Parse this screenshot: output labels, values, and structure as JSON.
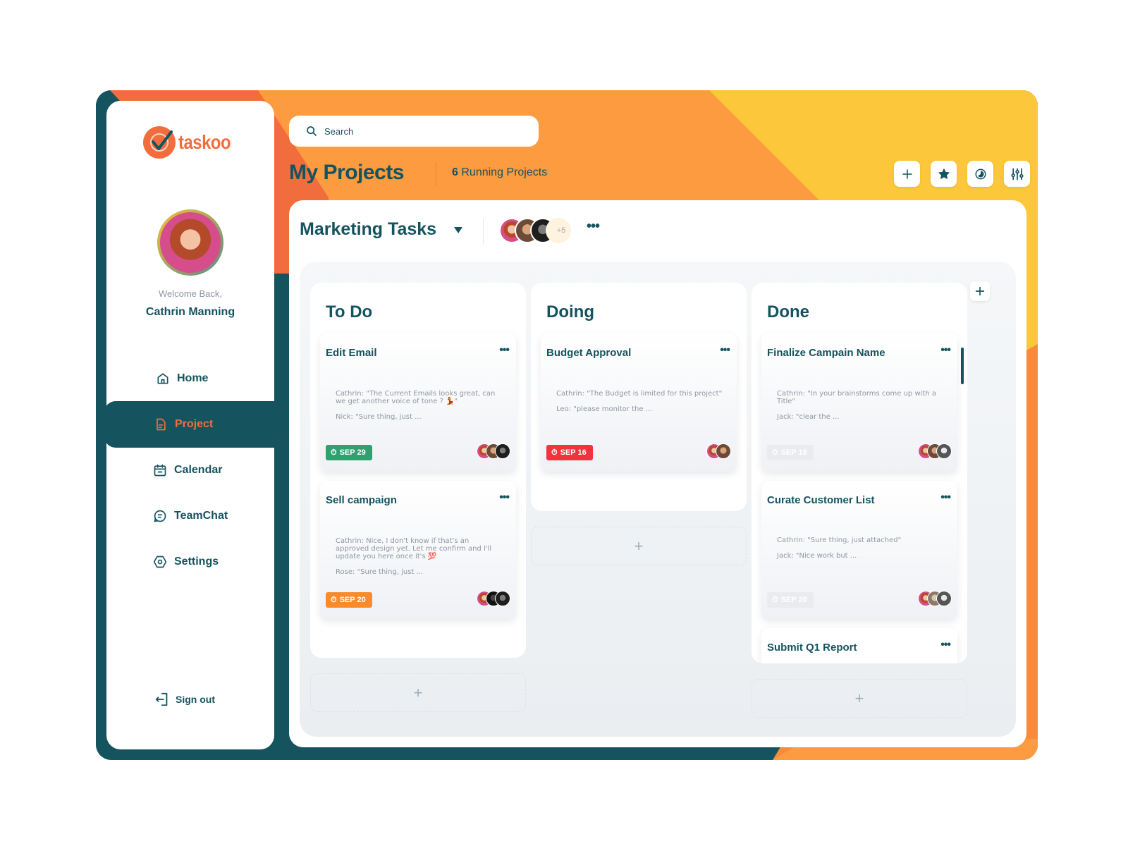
{
  "colors": {
    "teal": "#15535f",
    "orange": "#f26d3d",
    "orange_light": "#fc9b3f",
    "yellow": "#fcc73a",
    "badge_green": "#2fa16f",
    "badge_red": "#f2333d",
    "badge_orange": "#fb8b2a",
    "badge_muted": "#e9ebee"
  },
  "app": {
    "name": "taskoo"
  },
  "user": {
    "welcome": "Welcome Back,",
    "name": "Cathrin Manning"
  },
  "sidebar": {
    "items": [
      {
        "label": "Home",
        "icon": "home-icon",
        "active": false
      },
      {
        "label": "Project",
        "icon": "document-icon",
        "active": true
      },
      {
        "label": "Calendar",
        "icon": "calendar-icon",
        "active": false
      },
      {
        "label": "TeamChat",
        "icon": "chat-icon",
        "active": false
      },
      {
        "label": "Settings",
        "icon": "settings-icon",
        "active": false
      }
    ],
    "signout": "Sign out"
  },
  "header": {
    "search_placeholder": "Search",
    "title": "My Projects",
    "running_count": "6",
    "running_label": "Running Projects",
    "tools": [
      "plus-icon",
      "star-icon",
      "theme-icon",
      "filter-sliders-icon"
    ]
  },
  "board": {
    "title": "Marketing Tasks",
    "members_more": "+5",
    "columns": [
      {
        "title": "To Do",
        "cards": [
          {
            "title": "Edit Email",
            "messages": [
              "Cathrin:  \"The Current Emails looks great, can we get another voice of tone ? 💃\"",
              "Nick: \"Sure thing, just ..."
            ],
            "date": "SEP 29",
            "status": "green"
          },
          {
            "title": "Sell campaign",
            "messages": [
              "Cathrin:  Nice, I don't know if that's an approved design yet. Let me confirm and I'll update you here once it's 💯",
              "Rose: \"Sure thing, just ..."
            ],
            "date": "SEP 20",
            "status": "orange"
          }
        ]
      },
      {
        "title": "Doing",
        "cards": [
          {
            "title": "Budget Approval",
            "messages": [
              "Cathrin:  \"The Budget is limited for this project\"",
              "Leo: \"please monitor the ..."
            ],
            "date": "SEP 16",
            "status": "red"
          }
        ]
      },
      {
        "title": "Done",
        "cards": [
          {
            "title": "Finalize Campain Name",
            "messages": [
              "Cathrin:  \"In your brainstorms come up with a Title\"",
              "Jack: \"clear the ..."
            ],
            "date": "SEP 18",
            "status": "muted"
          },
          {
            "title": "Curate Customer List",
            "messages": [
              "Cathrin:  \"Sure thing, just attached\"",
              "Jack: \"Nice work but ..."
            ],
            "date": "SEP 20",
            "status": "muted"
          },
          {
            "title": "Submit Q1 Report",
            "messages": [],
            "date": "",
            "status": "muted"
          }
        ]
      }
    ],
    "add_symbol": "+"
  }
}
